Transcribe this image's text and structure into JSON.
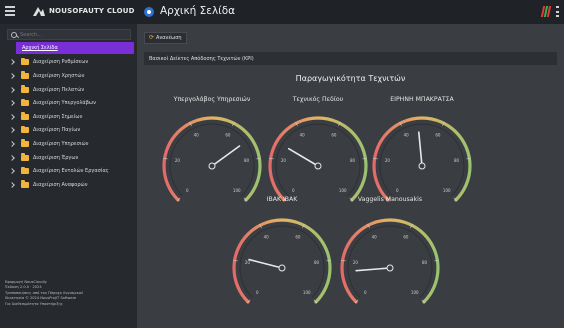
{
  "header": {
    "brand": "NOUSOFAUTY CLOUD",
    "title": "Αρχική Σελίδα"
  },
  "sidebar": {
    "search_placeholder": "Search...",
    "items": [
      {
        "label": "Αρχική Σελίδα",
        "active": true
      },
      {
        "label": "Διαχείριση Ρυθμίσεων"
      },
      {
        "label": "Διαχείριση Χρηστών"
      },
      {
        "label": "Διαχείριση Πελατών"
      },
      {
        "label": "Διαχείριση Υπεργολάβων"
      },
      {
        "label": "Διαχείριση Σημείων"
      },
      {
        "label": "Διαχείριση Παγίων"
      },
      {
        "label": "Διαχείριση Υπηρεσιών"
      },
      {
        "label": "Διαχείριση Έργων"
      },
      {
        "label": "Διαχείριση Εντολών Εργασίας"
      },
      {
        "label": "Διαχείριση Αναφορών"
      }
    ],
    "footer_lines": [
      "Εφαρμογή NousCloudly",
      "Έκδοση 2.0.0 · 2024",
      "Τροποποιήσεις από τον Πάροχο Λογισμικού",
      "Ιδιοκτησία © 2024 NousProjIT Software",
      "Για διαθεσιμότητα Υποστήριξης"
    ]
  },
  "main": {
    "refresh_label": "Ανανέωση",
    "kpi_title": "Βασικοί Δείκτες Απόδοσης Τεχνιτών (KPI)"
  },
  "colors": {
    "accent": "#7a2fd6",
    "gauge_low": "#e36a6a",
    "gauge_mid": "#e3b462",
    "gauge_high": "#9bc270",
    "needle": "#e8e8e8"
  },
  "chart_data": {
    "type": "gauge",
    "title": "Παραγωγικότητα Τεχνιτών",
    "min": 0,
    "max": 100,
    "ticks": [
      0,
      20,
      40,
      60,
      80,
      100
    ],
    "gauges": [
      {
        "name": "Υπεργολάβος Υπηρεσιών",
        "value": 70
      },
      {
        "name": "Τεχνικός Πεδίου",
        "value": 28
      },
      {
        "name": "ΕΙΡΗΝΗ ΜΠΑΚΡΑΤΣΑ",
        "value": 48
      },
      {
        "name": "IBAK IBAK",
        "value": 22
      },
      {
        "name": "Vaggelis Manousakis",
        "value": 15
      }
    ]
  }
}
